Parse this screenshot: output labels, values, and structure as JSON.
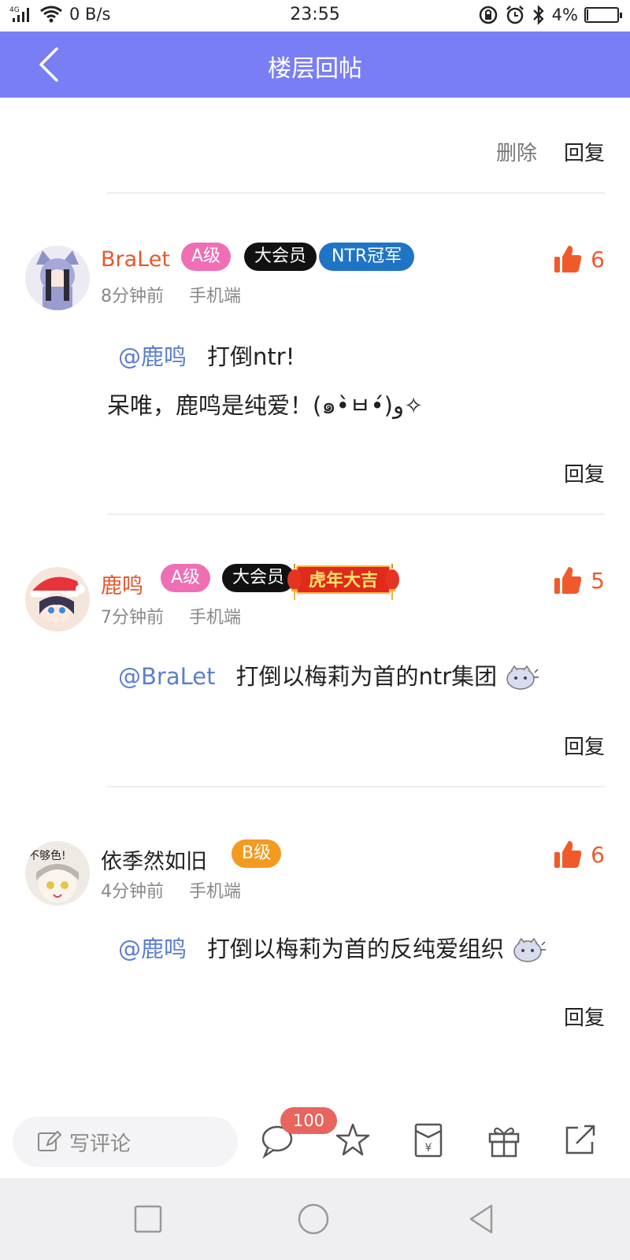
{
  "status": {
    "network": "4G",
    "speed": "0 B/s",
    "time": "23:55",
    "battery": "4%",
    "battery_level": 0.04
  },
  "topbar": {
    "title": "楼层回帖"
  },
  "top_actions": {
    "delete": "删除",
    "reply": "回复"
  },
  "comments": [
    {
      "user": "BraLet",
      "user_color": "#e8572a",
      "badges": [
        "A级",
        "大会员",
        "NTR冠军"
      ],
      "time": "8分钟前",
      "device": "手机端",
      "likes": "6",
      "mention": "@鹿鸣",
      "text1": "打倒ntr!",
      "text2": "呆唯，鹿鸣是纯爱！(๑•̀ㅂ•́)و✧",
      "reply": "回复"
    },
    {
      "user": "鹿鸣",
      "user_color": "#e8572a",
      "badges": [
        "A级",
        "大会员",
        "虎年大吉"
      ],
      "time": "7分钟前",
      "device": "手机端",
      "likes": "5",
      "mention": "@BraLet",
      "text1": "打倒以梅莉为首的ntr集团",
      "reply": "回复"
    },
    {
      "user": "依季然如旧",
      "user_color": "#222222",
      "avatar_text": "不够色!",
      "badges": [
        "B级"
      ],
      "time": "4分钟前",
      "device": "手机端",
      "likes": "6",
      "mention": "@鹿鸣",
      "text1": "打倒以梅莉为首的反纯爱组织",
      "reply": "回复"
    }
  ],
  "bottombar": {
    "comment_placeholder": "写评论",
    "comment_count": "100"
  },
  "colors": {
    "accent": "#7a7ef5",
    "like": "#f05a2a",
    "mention": "#5b7fcf"
  }
}
